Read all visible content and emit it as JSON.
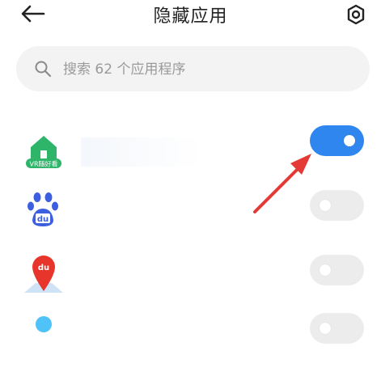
{
  "header": {
    "title": "隐藏应用",
    "back_icon": "arrow-left-icon",
    "settings_icon": "gear-icon"
  },
  "search": {
    "placeholder": "搜索 62 个应用程序",
    "value": ""
  },
  "apps": [
    {
      "icon": "vr-house-app-icon",
      "icon_text": "VR随好看",
      "hidden": true
    },
    {
      "icon": "baidu-paw-app-icon",
      "icon_text": "du",
      "hidden": false
    },
    {
      "icon": "baidu-map-app-icon",
      "icon_text": "du",
      "hidden": false
    },
    {
      "icon": "partial-app-icon",
      "icon_text": "",
      "hidden": false
    }
  ],
  "colors": {
    "toggle_on": "#2f86ef",
    "toggle_off": "#ececec",
    "annotation_arrow": "#e53935"
  }
}
